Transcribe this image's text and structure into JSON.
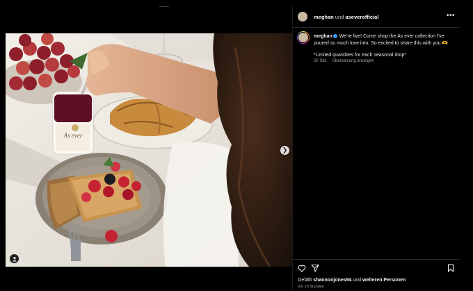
{
  "post": {
    "author": "meghan",
    "connector": "und",
    "collaborator": "aseverofficial",
    "more_label": "•••",
    "caption_author": "meghan",
    "caption_text": "We're live! Come shop the As ever collection I've poured so much love into. So excited to share this with you 🫶",
    "caption_note": "*Limited quantities for each seasonal drop*",
    "caption_age": "20 Std.",
    "translate_label": "Übersetzung anzeigen",
    "likes_prefix": "Gefällt",
    "likes_user": "shannonjones94",
    "likes_middle": "und",
    "likes_rest": "weiteren Personen",
    "timestamp": "Vor 20 Stunden"
  },
  "carousel": {
    "next_icon": "chevron-right-icon",
    "total_slides": 3,
    "active_slide": 1
  },
  "image": {
    "label_on_jar": "As ever"
  },
  "colors": {
    "background": "#000000",
    "verified": "#3897f0",
    "active_dot": "#2a7bf4",
    "muted_text": "#a8a8a8"
  },
  "icons": {
    "like": "heart-outline-icon",
    "share": "paper-plane-icon",
    "save": "bookmark-outline-icon",
    "tag": "user-tag-icon"
  }
}
